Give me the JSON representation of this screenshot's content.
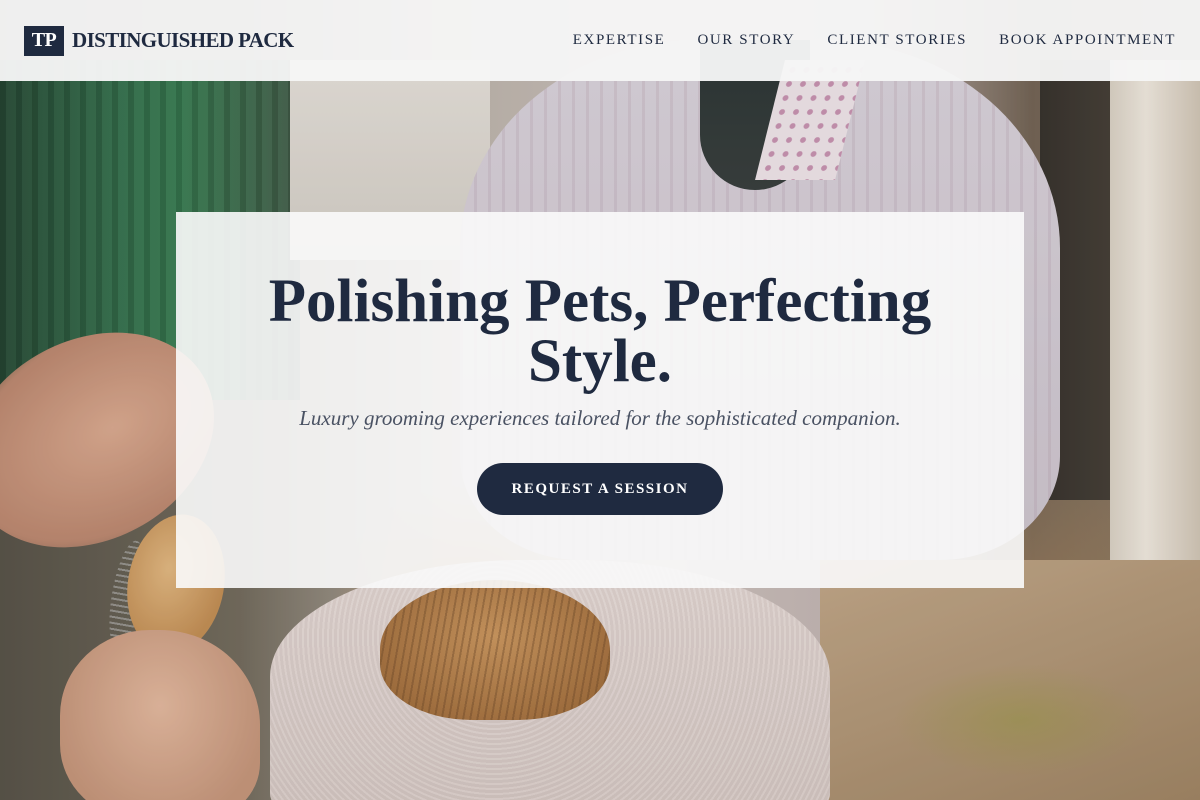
{
  "header": {
    "logo_mark": "TP",
    "brand_name": "DISTINGUISHED PACK",
    "nav": [
      {
        "label": "EXPERTISE"
      },
      {
        "label": "OUR STORY"
      },
      {
        "label": "CLIENT STORIES"
      },
      {
        "label": "BOOK APPOINTMENT"
      }
    ]
  },
  "hero": {
    "title": "Polishing Pets, Perfecting Style.",
    "subtitle": "Luxury grooming experiences tailored for the sophisticated companion.",
    "cta_label": "REQUEST A SESSION",
    "background_image": "dog-grooming-photo"
  },
  "colors": {
    "brand_navy": "#1f2a40",
    "header_bg": "#f6f6f6",
    "card_bg": "#fafafa",
    "subtitle_gray": "#4a5263"
  }
}
